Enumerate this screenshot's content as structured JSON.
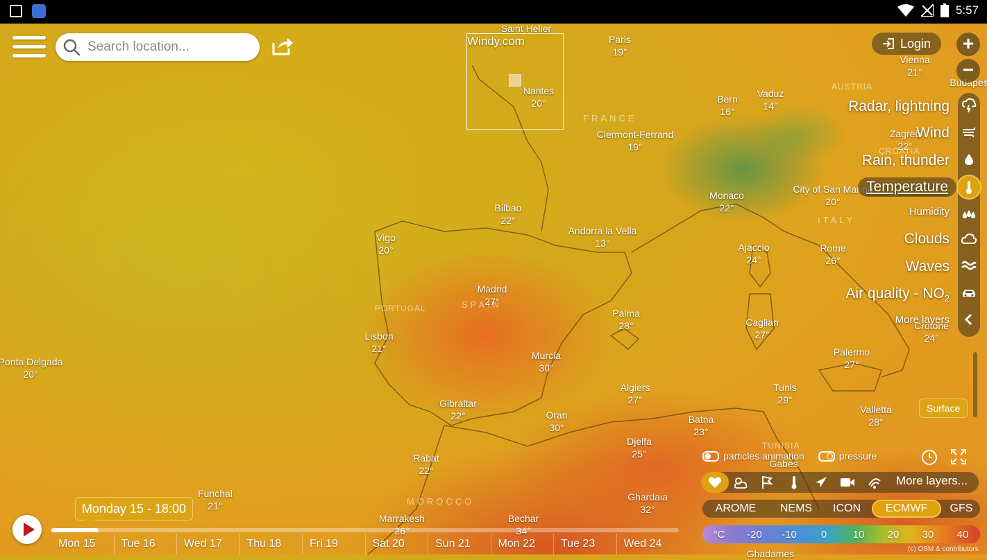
{
  "statusbar": {
    "time": "5:57",
    "left_icons": [
      "image-icon",
      "app-icon"
    ],
    "right_icons": [
      "wifi-icon",
      "signal-icon",
      "battery-icon"
    ]
  },
  "header": {
    "search_placeholder": "Search location...",
    "brand": "Windy.com",
    "login_label": "Login"
  },
  "cities": [
    {
      "name": "Saint Helier",
      "temp": ""
    },
    {
      "name": "Paris",
      "temp": "19°"
    },
    {
      "name": "Vienna",
      "temp": "21°"
    },
    {
      "name": "Budapes",
      "temp": ""
    },
    {
      "name": "Nantes",
      "temp": "20°"
    },
    {
      "name": "Bern",
      "temp": "16°"
    },
    {
      "name": "Vaduz",
      "temp": "14°"
    },
    {
      "name": "Zagreb",
      "temp": "22°"
    },
    {
      "name": "Clermont-Ferrand",
      "temp": "19°"
    },
    {
      "name": "Monaco",
      "temp": "22°"
    },
    {
      "name": "City of San Marino",
      "temp": "20°"
    },
    {
      "name": "Bilbao",
      "temp": "22°"
    },
    {
      "name": "Andorra la Vella",
      "temp": "13°"
    },
    {
      "name": "Vigo",
      "temp": "20°"
    },
    {
      "name": "Ajaccio",
      "temp": "24°"
    },
    {
      "name": "Rome",
      "temp": "26°"
    },
    {
      "name": "Madrid",
      "temp": "27°"
    },
    {
      "name": "Palma",
      "temp": "28°"
    },
    {
      "name": "Cagliari",
      "temp": "27°"
    },
    {
      "name": "Crotone",
      "temp": "24°"
    },
    {
      "name": "Lisbon",
      "temp": "21°"
    },
    {
      "name": "Murcia",
      "temp": "30°"
    },
    {
      "name": "Palermo",
      "temp": "27°"
    },
    {
      "name": "Ponta Delgada",
      "temp": "20°"
    },
    {
      "name": "Algiers",
      "temp": "27°"
    },
    {
      "name": "Tunis",
      "temp": "29°"
    },
    {
      "name": "Gibraltar",
      "temp": "22°"
    },
    {
      "name": "Valletta",
      "temp": "28°"
    },
    {
      "name": "Oran",
      "temp": "30°"
    },
    {
      "name": "Batna",
      "temp": "23°"
    },
    {
      "name": "Djelfa",
      "temp": "25°"
    },
    {
      "name": "Rabat",
      "temp": "22°"
    },
    {
      "name": "Funchal",
      "temp": "21°"
    },
    {
      "name": "Ghardaia",
      "temp": "32°"
    },
    {
      "name": "Marrakesh",
      "temp": "26°"
    },
    {
      "name": "Bechar",
      "temp": "34°"
    },
    {
      "name": "Gabes",
      "temp": ""
    },
    {
      "name": "Ghadames",
      "temp": ""
    }
  ],
  "countries": [
    "FRANCE",
    "AUSTRIA",
    "CROATIA",
    "ITALY",
    "PORTUGAL",
    "SPAIN",
    "TUNISIA",
    "MOROCCO"
  ],
  "layers": [
    {
      "label": "Radar, lightning",
      "icon": "radar-icon"
    },
    {
      "label": "Wind",
      "icon": "wind-icon"
    },
    {
      "label": "Rain, thunder",
      "icon": "rain-drop-icon"
    },
    {
      "label": "Temperature",
      "icon": "thermometer-icon"
    },
    {
      "label": "Humidity",
      "icon": "humidity-icon"
    },
    {
      "label": "Clouds",
      "icon": "cloud-icon"
    },
    {
      "label": "Waves",
      "icon": "waves-icon"
    },
    {
      "label": "Air quality - NO",
      "sub": "2",
      "icon": "car-icon"
    },
    {
      "label": "More layers",
      "icon": "chevron-left-icon"
    }
  ],
  "active_layer": "Temperature",
  "surface_label": "Surface",
  "toggles": {
    "particles": "particles animation",
    "pressure": "pressure"
  },
  "favorites": {
    "more_label": "More layers...",
    "icons": [
      "heart-icon",
      "sun-cloud-icon",
      "flag-icon",
      "thermometer-icon",
      "airplane-icon",
      "camera-icon",
      "satellite-icon"
    ]
  },
  "models": {
    "items": [
      "AROME",
      "NEMS",
      "ICON",
      "ECMWF",
      "GFS"
    ],
    "active": "ECMWF"
  },
  "legend": {
    "unit": "°C",
    "values": [
      "-20",
      "-10",
      "0",
      "10",
      "20",
      "30",
      "40"
    ]
  },
  "timeline": {
    "current": "Monday 15 - 18:00",
    "progress": 0.075,
    "days": [
      "Mon 15",
      "Tue 16",
      "Wed 17",
      "Thu 18",
      "Fri 19",
      "Sat 20",
      "Sun 21",
      "Mon 22",
      "Tue 23",
      "Wed 24"
    ]
  },
  "copyright": "(c) OSM & contributors",
  "colors": {
    "accent": "#e0a10f",
    "play": "#c0161c"
  }
}
